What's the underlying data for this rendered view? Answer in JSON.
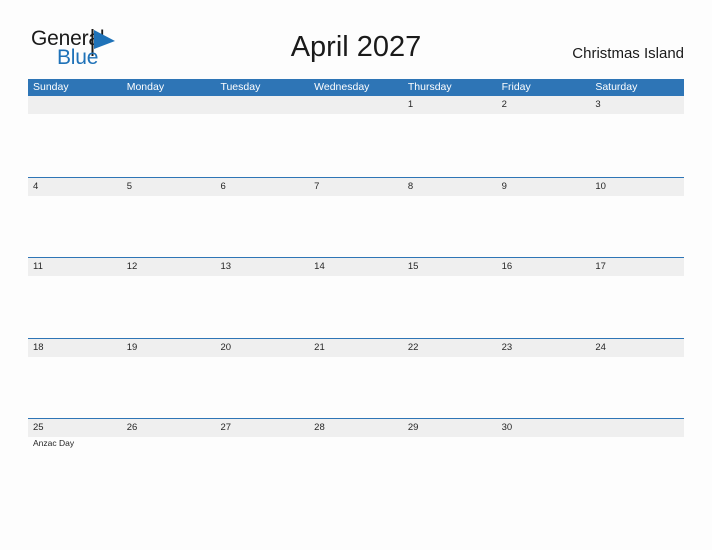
{
  "brand": {
    "name_part1": "General",
    "name_part2": "Blue",
    "flag_icon": "blue-flag-triangle",
    "accent_color": "#1f72b8"
  },
  "header": {
    "title": "April 2027",
    "region": "Christmas Island"
  },
  "colors": {
    "header_blue": "#2e75b6",
    "row_band_gray": "#efefef",
    "page_background": "#fdfdfd",
    "text_dark": "#262626",
    "header_text": "#ffffff"
  },
  "calendar": {
    "month": "April",
    "year": "2027",
    "weekday_headers": [
      "Sunday",
      "Monday",
      "Tuesday",
      "Wednesday",
      "Thursday",
      "Friday",
      "Saturday"
    ],
    "weeks": [
      {
        "days": [
          {
            "number": "",
            "events": []
          },
          {
            "number": "",
            "events": []
          },
          {
            "number": "",
            "events": []
          },
          {
            "number": "",
            "events": []
          },
          {
            "number": "1",
            "events": []
          },
          {
            "number": "2",
            "events": []
          },
          {
            "number": "3",
            "events": []
          }
        ]
      },
      {
        "days": [
          {
            "number": "4",
            "events": []
          },
          {
            "number": "5",
            "events": []
          },
          {
            "number": "6",
            "events": []
          },
          {
            "number": "7",
            "events": []
          },
          {
            "number": "8",
            "events": []
          },
          {
            "number": "9",
            "events": []
          },
          {
            "number": "10",
            "events": []
          }
        ]
      },
      {
        "days": [
          {
            "number": "11",
            "events": []
          },
          {
            "number": "12",
            "events": []
          },
          {
            "number": "13",
            "events": []
          },
          {
            "number": "14",
            "events": []
          },
          {
            "number": "15",
            "events": []
          },
          {
            "number": "16",
            "events": []
          },
          {
            "number": "17",
            "events": []
          }
        ]
      },
      {
        "days": [
          {
            "number": "18",
            "events": []
          },
          {
            "number": "19",
            "events": []
          },
          {
            "number": "20",
            "events": []
          },
          {
            "number": "21",
            "events": []
          },
          {
            "number": "22",
            "events": []
          },
          {
            "number": "23",
            "events": []
          },
          {
            "number": "24",
            "events": []
          }
        ]
      },
      {
        "days": [
          {
            "number": "25",
            "events": [
              "Anzac Day"
            ]
          },
          {
            "number": "26",
            "events": []
          },
          {
            "number": "27",
            "events": []
          },
          {
            "number": "28",
            "events": []
          },
          {
            "number": "29",
            "events": []
          },
          {
            "number": "30",
            "events": []
          },
          {
            "number": "",
            "events": []
          }
        ]
      }
    ]
  }
}
